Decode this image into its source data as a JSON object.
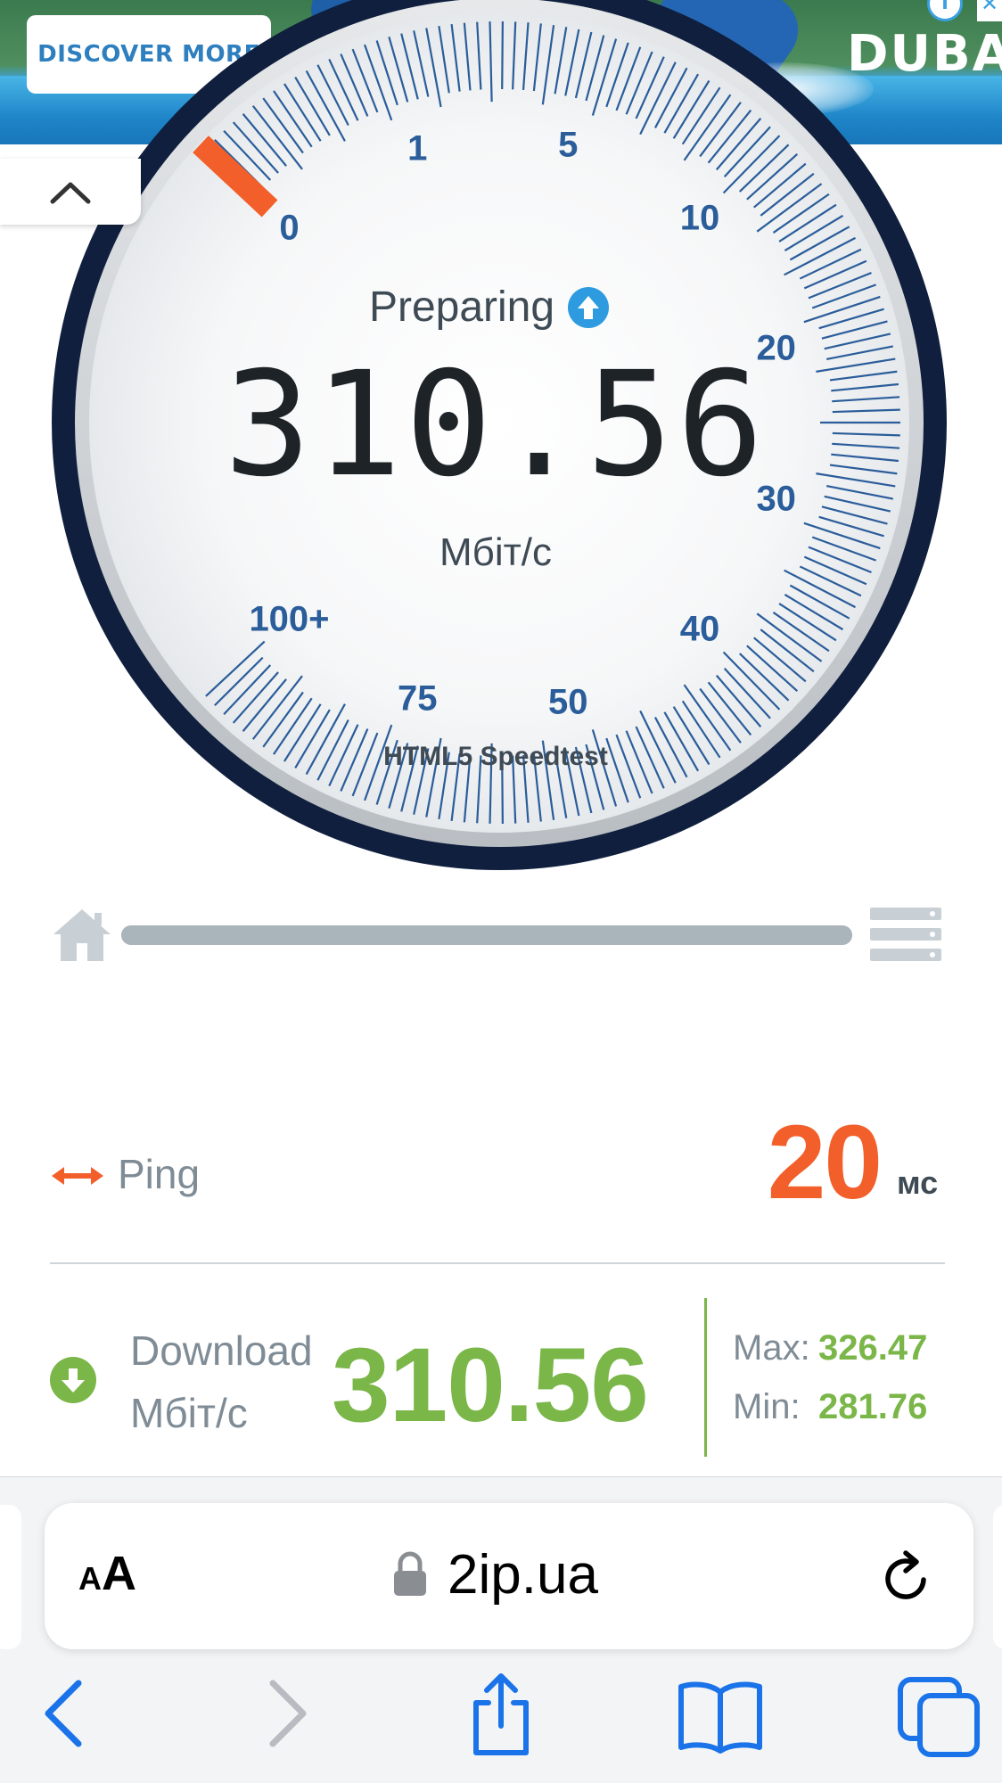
{
  "ad": {
    "button_label": "DISCOVER MORE",
    "brand_text": "DUBAI",
    "info_glyph": "i",
    "close_glyph": "✕"
  },
  "collapse_icon": "chevron-up-icon",
  "gauge": {
    "status_text": "Preparing",
    "status_icon": "arrow-up-circle-icon",
    "speed_value": "310.56",
    "speed_unit": "Мбіт/с",
    "brand": "HTML5 Speedtest",
    "scale_labels": [
      "0",
      "1",
      "5",
      "10",
      "20",
      "30",
      "40",
      "50",
      "75",
      "100+"
    ],
    "needle_fraction": 0.0,
    "colors": {
      "accent": "#f25f2a",
      "scale": "#2a5d9a",
      "rim": "#0f1f3d"
    }
  },
  "progress": {
    "fraction": 1.0,
    "left_icon": "home-icon",
    "right_icon": "server-icon"
  },
  "ping": {
    "label": "Ping",
    "value": "20",
    "unit": "мс",
    "icon": "double-arrow-icon"
  },
  "download": {
    "label_line1": "Download",
    "label_line2": "Мбіт/с",
    "value": "310.56",
    "icon": "arrow-down-circle-icon",
    "max_label": "Max:",
    "max_value": "326.47",
    "min_label": "Min:",
    "min_value": "281.76",
    "color": "#7ab648"
  },
  "browser": {
    "aa_small": "A",
    "aa_big": "A",
    "url": "2ip.ua",
    "lock_icon": "lock-icon",
    "reload_icon": "reload-icon",
    "nav": [
      "back-icon",
      "forward-icon",
      "share-icon",
      "bookmarks-icon",
      "tabs-icon"
    ],
    "tint": "#1a73e8"
  }
}
